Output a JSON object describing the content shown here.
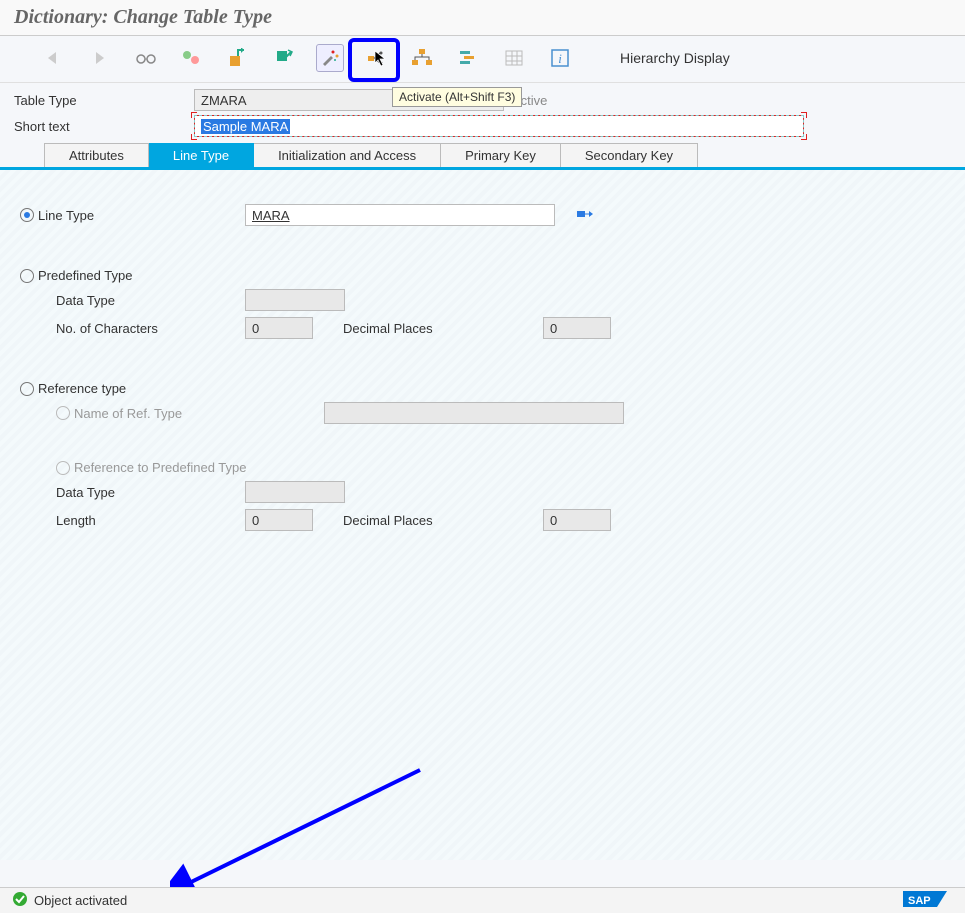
{
  "title": "Dictionary: Change Table Type",
  "toolbar": {
    "hierarchy_label": "Hierarchy Display",
    "tooltip": "Activate (Alt+Shift F3)"
  },
  "form": {
    "table_type_label": "Table Type",
    "table_type_value": "ZMARA",
    "status_label": "Active",
    "short_text_label": "Short text",
    "short_text_value": "Sample MARA"
  },
  "tabs": {
    "attributes": "Attributes",
    "line_type": "Line Type",
    "init_access": "Initialization and Access",
    "primary_key": "Primary Key",
    "secondary_key": "Secondary Key"
  },
  "linetype": {
    "line_type_label": "Line Type",
    "line_type_value": "MARA",
    "predef_label": "Predefined Type",
    "data_type_label": "Data Type",
    "num_chars_label": "No. of Characters",
    "num_chars_value": "0",
    "dec_places_label": "Decimal Places",
    "dec_places_value": "0",
    "ref_type_label": "Reference type",
    "name_ref_label": "Name of Ref. Type",
    "ref_predef_label": "Reference to Predefined Type",
    "ref_data_type_label": "Data Type",
    "length_label": "Length",
    "length_value": "0",
    "ref_dec_label": "Decimal Places",
    "ref_dec_value": "0"
  },
  "status": {
    "message": "Object activated"
  }
}
